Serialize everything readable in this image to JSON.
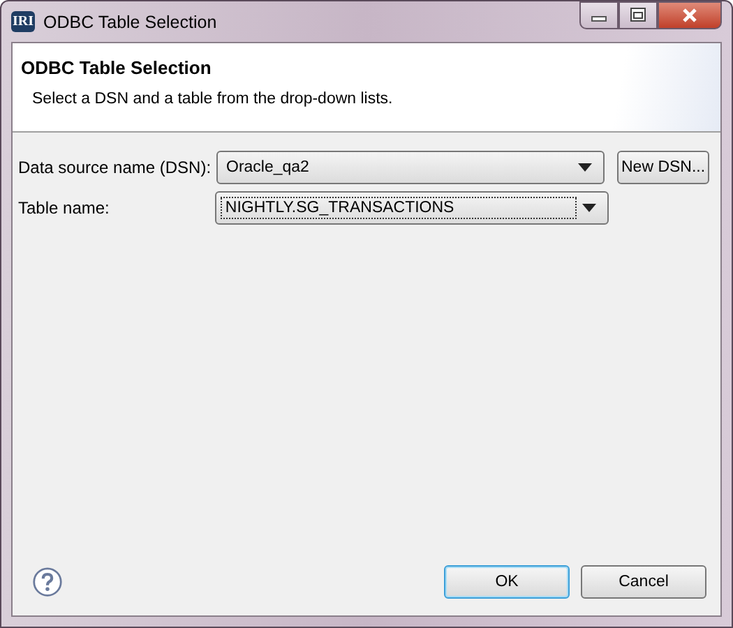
{
  "window": {
    "logo": "IRI",
    "title": "ODBC Table Selection"
  },
  "header": {
    "title": "ODBC Table Selection",
    "description": "Select a DSN and a table from the drop-down lists."
  },
  "fields": [
    {
      "label": "Data source name (DSN):",
      "value": "Oracle_qa2",
      "focused": false,
      "button": "New DSN..."
    },
    {
      "label": "Table name:",
      "value": "NIGHTLY.SG_TRANSACTIONS",
      "focused": true
    }
  ],
  "buttons": [
    {
      "label": "OK",
      "default": true
    },
    {
      "label": "Cancel",
      "default": false
    }
  ]
}
